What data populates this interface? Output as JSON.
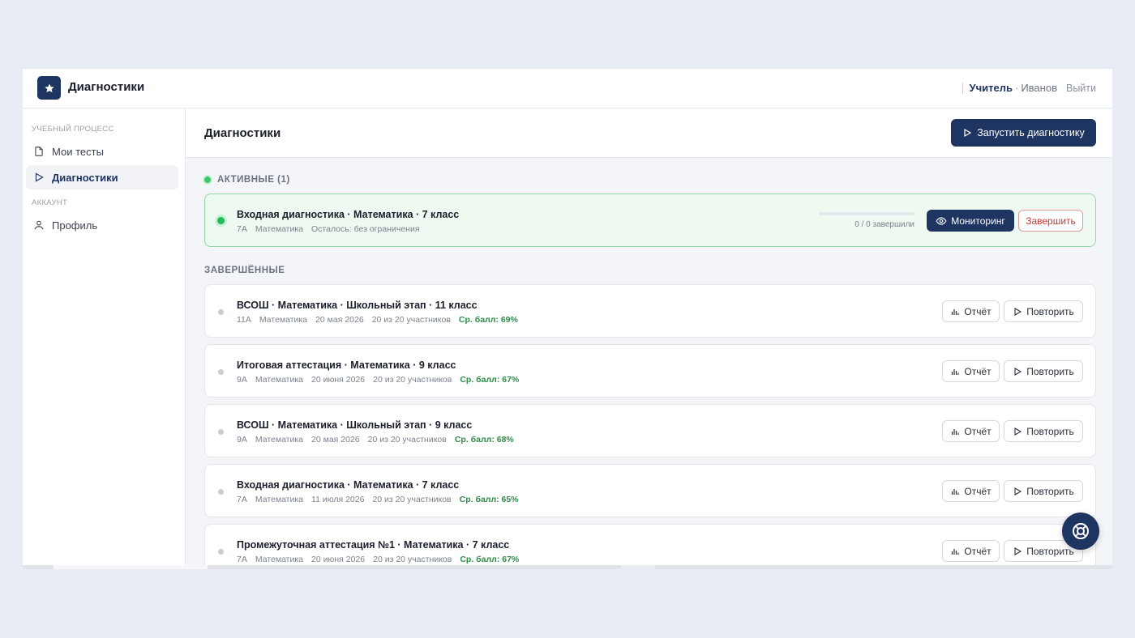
{
  "app": {
    "title": "Диагностики"
  },
  "user": {
    "role": "Учитель",
    "separator": "·",
    "name": "Иванов",
    "logout_label": "Выйти"
  },
  "sidebar": {
    "sections": [
      {
        "label": "Учебный процесс"
      },
      {
        "label": "Аккаунт"
      }
    ],
    "items": [
      {
        "label": "Мои тесты",
        "icon": "document-icon",
        "active": false
      },
      {
        "label": "Диагностики",
        "icon": "play-icon",
        "active": true
      },
      {
        "label": "Профиль",
        "icon": "user-icon",
        "active": false
      }
    ]
  },
  "main": {
    "title": "Диагностики",
    "launch_label": "Запустить диагностику"
  },
  "active_section": {
    "label": "АКТИВНЫЕ (1)",
    "items": [
      {
        "title": "Входная диагностика · Математика · 7 класс",
        "class": "7А",
        "subject": "Математика",
        "remaining": "Осталось: без ограничения",
        "progress_text": "0 / 0 завершили",
        "progress_fraction": 0,
        "monitor_label": "Мониторинг",
        "finish_label": "Завершить"
      }
    ]
  },
  "completed_section": {
    "label": "ЗАВЕРШЁННЫЕ",
    "report_label": "Отчёт",
    "repeat_label": "Повторить",
    "items": [
      {
        "title": "ВСОШ · Математика · Школьный этап · 11 класс",
        "class": "11А",
        "subject": "Математика",
        "date": "20 мая 2026",
        "participants": "20 из 20 участников",
        "score": "Ср. балл: 69%"
      },
      {
        "title": "Итоговая аттестация · Математика · 9 класс",
        "class": "9А",
        "subject": "Математика",
        "date": "20 июня 2026",
        "participants": "20 из 20 участников",
        "score": "Ср. балл: 67%"
      },
      {
        "title": "ВСОШ · Математика · Школьный этап · 9 класс",
        "class": "9А",
        "subject": "Математика",
        "date": "20 мая 2026",
        "participants": "20 из 20 участников",
        "score": "Ср. балл: 68%"
      },
      {
        "title": "Входная диагностика · Математика · 7 класс",
        "class": "7А",
        "subject": "Математика",
        "date": "11 июля 2026",
        "participants": "20 из 20 участников",
        "score": "Ср. балл: 65%"
      },
      {
        "title": "Промежуточная аттестация №1 · Математика · 7 класс",
        "class": "7А",
        "subject": "Математика",
        "date": "20 июня 2026",
        "participants": "20 из 20 участников",
        "score": "Ср. балл: 67%"
      }
    ]
  },
  "colors": {
    "primary": "#1e3461",
    "active_green": "#27b95a",
    "score_green": "#2e8b4a",
    "danger": "#c43a3a"
  }
}
